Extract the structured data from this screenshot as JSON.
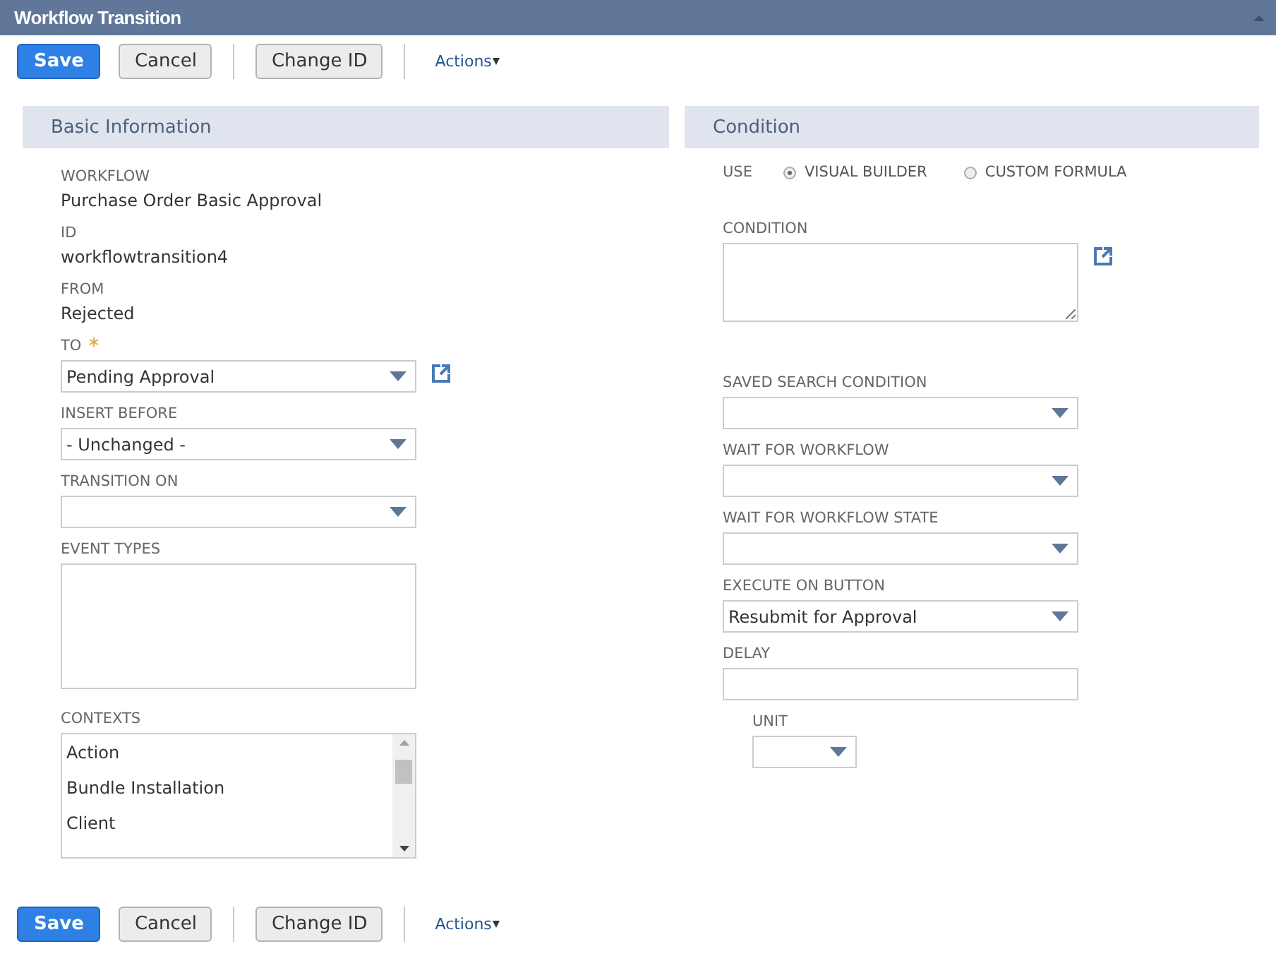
{
  "window": {
    "title": "Workflow Transition"
  },
  "toolbar_top": {
    "buttons": [
      {
        "label": "Save",
        "kind": "primary"
      },
      {
        "label": "Cancel",
        "kind": "secondary"
      },
      {
        "label": "Change ID",
        "kind": "secondary"
      }
    ],
    "actions": "Actions"
  },
  "basic_information": {
    "title": "Basic Information",
    "fields": [
      {
        "kind": "static",
        "label": "WORKFLOW",
        "value": "Purchase Order Basic Approval"
      },
      {
        "kind": "static",
        "label": "ID",
        "value": "workflowtransition4"
      },
      {
        "kind": "static",
        "label": "FROM",
        "value": "Rejected"
      },
      {
        "kind": "select",
        "label": "TO",
        "required_mark": "*",
        "value": "Pending Approval",
        "link": true
      },
      {
        "kind": "select",
        "label": "INSERT BEFORE",
        "value": "- Unchanged -"
      },
      {
        "kind": "select",
        "label": "TRANSITION ON"
      },
      {
        "kind": "textarea",
        "label": "EVENT TYPES"
      },
      {
        "kind": "listbox",
        "label": "CONTEXTS",
        "options": [
          "Action",
          "Bundle Installation",
          "Client"
        ]
      }
    ]
  },
  "condition": {
    "title": "Condition",
    "fields": [
      {
        "kind": "radio",
        "label": "USE",
        "options": [
          {
            "label": "VISUAL BUILDER",
            "selected": true
          },
          {
            "label": "CUSTOM FORMULA",
            "selected": false
          }
        ]
      },
      {
        "kind": "resizable-textarea",
        "label": "CONDITION",
        "link": true
      },
      {
        "kind": "select",
        "label": "SAVED SEARCH CONDITION"
      },
      {
        "kind": "select",
        "label": "WAIT FOR WORKFLOW"
      },
      {
        "kind": "select",
        "label": "WAIT FOR WORKFLOW STATE"
      },
      {
        "kind": "select",
        "label": "EXECUTE ON BUTTON",
        "value": "Resubmit for Approval"
      },
      {
        "kind": "text",
        "label": "DELAY"
      },
      {
        "kind": "small-select",
        "label": "UNIT"
      }
    ]
  },
  "toolbar_bottom": {
    "buttons": [
      {
        "label": "Save",
        "kind": "primary"
      },
      {
        "label": "Cancel",
        "kind": "secondary"
      },
      {
        "label": "Change ID",
        "kind": "secondary"
      }
    ],
    "actions": "Actions"
  }
}
